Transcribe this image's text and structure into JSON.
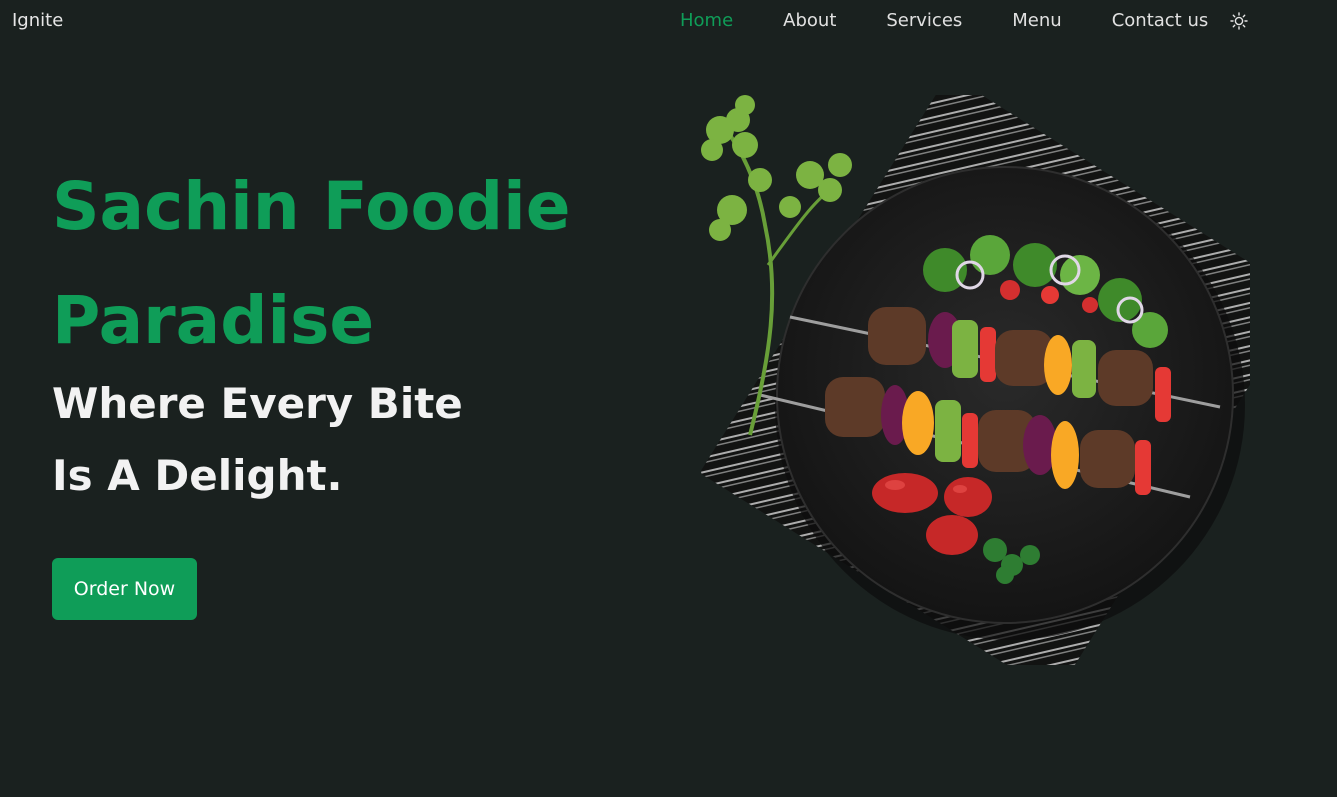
{
  "nav": {
    "logo": "Ignite",
    "links": [
      {
        "label": "Home",
        "active": true
      },
      {
        "label": "About",
        "active": false
      },
      {
        "label": "Services",
        "active": false
      },
      {
        "label": "Menu",
        "active": false
      },
      {
        "label": "Contact us",
        "active": false
      }
    ],
    "theme_icon": "sun-icon"
  },
  "hero": {
    "title": "Sachin Foodie Paradise",
    "subtitle": "Where Every Bite Is A Delight.",
    "cta_label": "Order Now",
    "image": "kebab-skewers-plate"
  },
  "colors": {
    "background": "#1a211f",
    "accent": "#0f9d58",
    "text": "#f2f2f2"
  }
}
